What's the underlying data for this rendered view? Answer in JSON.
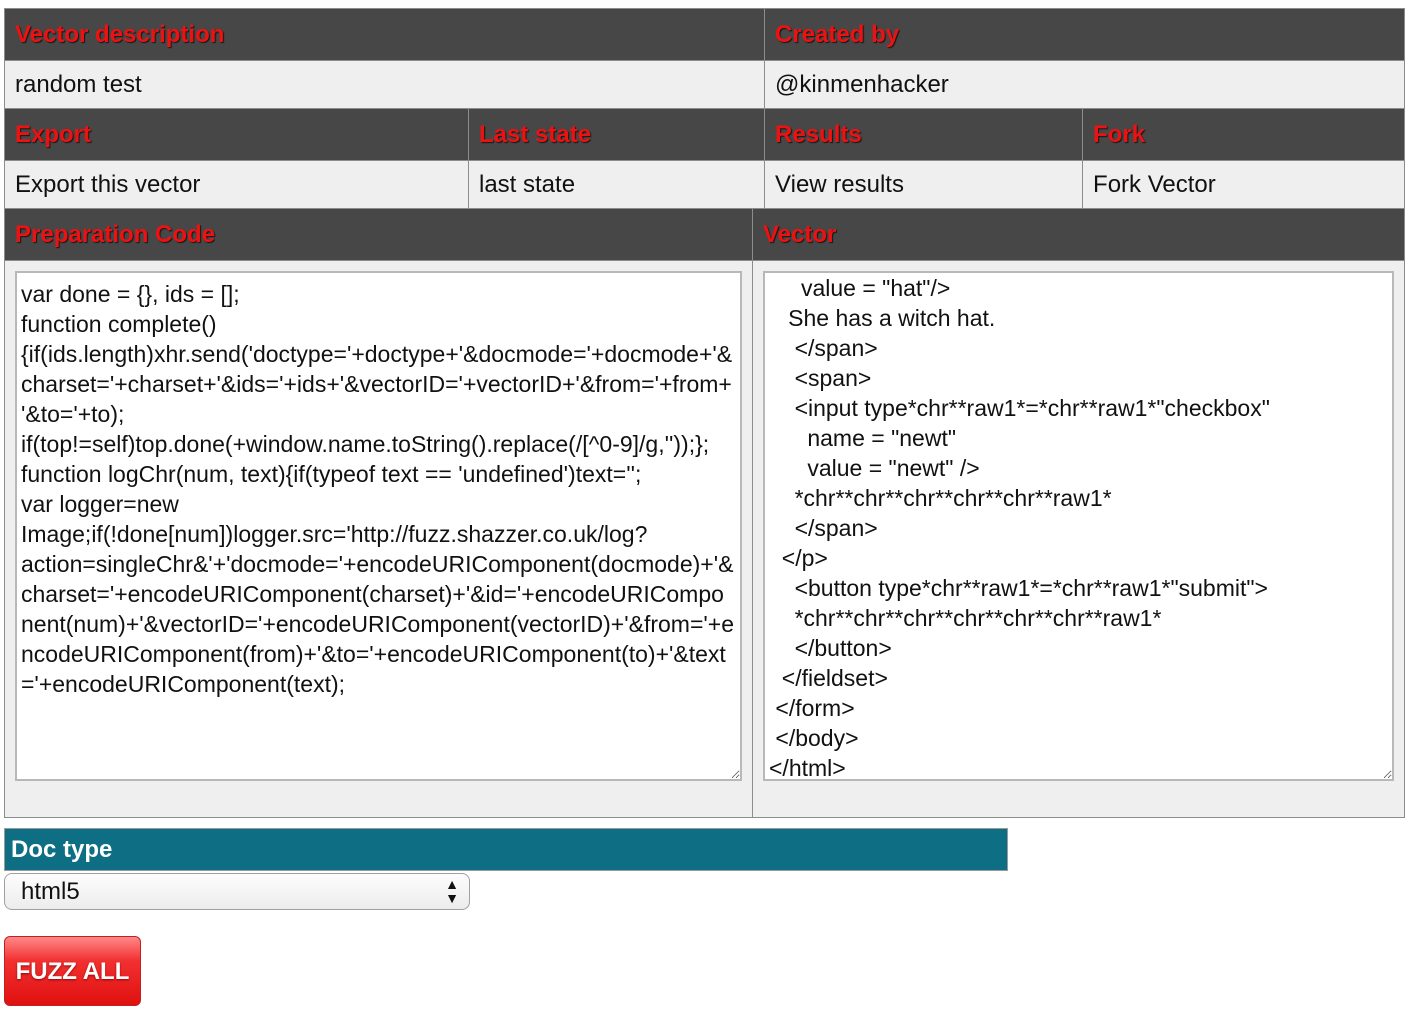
{
  "headers": {
    "vector_description": "Vector description",
    "created_by": "Created by",
    "export": "Export",
    "last_state": "Last state",
    "results": "Results",
    "fork": "Fork",
    "preparation_code": "Preparation Code",
    "vector": "Vector"
  },
  "values": {
    "vector_description": "random test",
    "created_by": "@kinmenhacker",
    "export_link": "Export this vector",
    "last_state_link": "last state",
    "results_link": "View results",
    "fork_link": "Fork Vector"
  },
  "preparation_code": "var done = {}, ids = [];\nfunction complete(){if(ids.length)xhr.send('doctype='+doctype+'&docmode='+docmode+'&charset='+charset+'&ids='+ids+'&vectorID='+vectorID+'&from='+from+'&to='+to);\nif(top!=self)top.done(+window.name.toString().replace(/[^0-9]/g,''));};\nfunction logChr(num, text){if(typeof text == 'undefined')text='';\nvar logger=new Image;if(!done[num])logger.src='http://fuzz.shazzer.co.uk/log?action=singleChr&'+'docmode='+encodeURIComponent(docmode)+'&charset='+encodeURIComponent(charset)+'&id='+encodeURIComponent(num)+'&vectorID='+encodeURIComponent(vectorID)+'&from='+encodeURIComponent(from)+'&to='+encodeURIComponent(to)+'&text='+encodeURIComponent(text);",
  "vector_code": "     value = \"hat\"/>\n   She has a witch hat.\n    </span>\n    <span>\n    <input type*chr**raw1*=*chr**raw1*\"checkbox\"\n      name = \"newt\"\n      value = \"newt\" />\n    *chr**chr**chr**chr**chr**raw1*\n    </span>\n  </p>\n    <button type*chr**raw1*=*chr**raw1*\"submit\">\n    *chr**chr**chr**chr**chr**chr**raw1*\n    </button>\n  </fieldset>\n </form>\n </body>\n</html>",
  "doctype": {
    "label": "Doc type",
    "selected": "html5"
  },
  "fuzz_button": "FUZZ ALL",
  "colors": {
    "header_bg": "#474747",
    "header_text": "#ee1111",
    "doctype_bar": "#0e6e84",
    "fuzz_button": "#e01010"
  }
}
